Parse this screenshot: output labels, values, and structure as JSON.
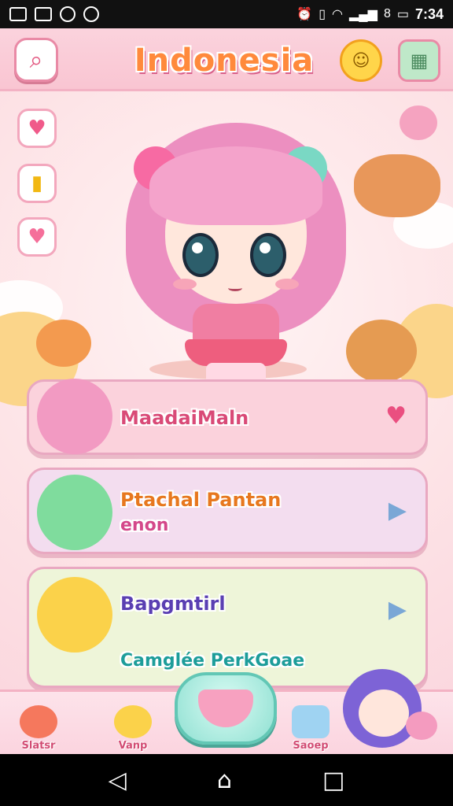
{
  "status_bar": {
    "time": "7:34",
    "battery": "8"
  },
  "header": {
    "title": "Indonesia",
    "search_icon": "search-icon",
    "mascot_icon": "mascot-icon",
    "map_icon": "map-icon"
  },
  "side_buttons": [
    {
      "icon": "heart-icon",
      "glyph": "♥"
    },
    {
      "icon": "card-icon",
      "glyph": "▮"
    },
    {
      "icon": "gem-heart-icon",
      "glyph": "♥"
    }
  ],
  "cards": [
    {
      "label": "MaadaiMaln",
      "sub": "",
      "action_icon": "heart-icon",
      "action_glyph": "♥",
      "bg": "#fbd2dc",
      "color": "#d94a77"
    },
    {
      "label": "Ptachal Pantan",
      "sub": "enon",
      "action_icon": "play-arrow-icon",
      "action_glyph": "▶",
      "bg": "#f3ddef",
      "color": "#e7781f"
    },
    {
      "label": "Bapgmtirl",
      "sub": "Camglée PerkGoae",
      "action_icon": "play-arrow-icon",
      "action_glyph": "▶",
      "bg": "#eef5d9",
      "color": "#5a3fb2"
    }
  ],
  "bottom_nav": [
    {
      "label": "Slatsr",
      "icon": "fruit-icon"
    },
    {
      "label": "Vanp",
      "icon": "sun-icon"
    },
    {
      "label": "Saoep",
      "icon": "robot-icon"
    }
  ],
  "system_nav": {
    "back": "◁",
    "home": "⌂",
    "recents": "□"
  },
  "colors": {
    "accent": "#e35a82",
    "title": "#ff8a3c",
    "teal": "#62c7b5"
  }
}
